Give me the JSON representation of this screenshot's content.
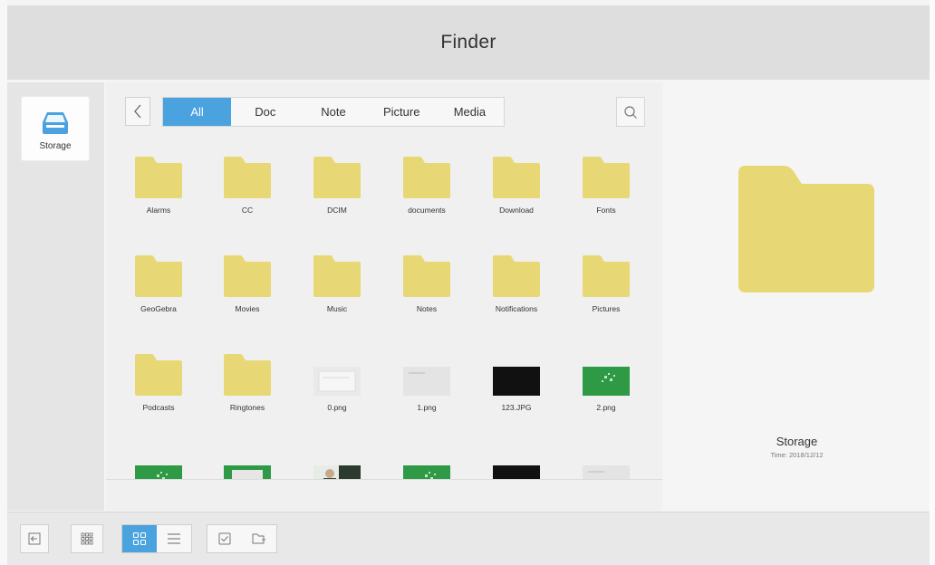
{
  "window": {
    "title": "Finder"
  },
  "sidebar": {
    "storage_label": "Storage",
    "storage_icon": "tray-icon"
  },
  "tabs": [
    {
      "label": "All",
      "active": true
    },
    {
      "label": "Doc",
      "active": false
    },
    {
      "label": "Note",
      "active": false
    },
    {
      "label": "Picture",
      "active": false
    },
    {
      "label": "Media",
      "active": false
    }
  ],
  "files": [
    {
      "name": "Alarms",
      "kind": "folder"
    },
    {
      "name": "CC",
      "kind": "folder"
    },
    {
      "name": "DCIM",
      "kind": "folder"
    },
    {
      "name": "documents",
      "kind": "folder"
    },
    {
      "name": "Download",
      "kind": "folder"
    },
    {
      "name": "Fonts",
      "kind": "folder"
    },
    {
      "name": "GeoGebra",
      "kind": "folder"
    },
    {
      "name": "Movies",
      "kind": "folder"
    },
    {
      "name": "Music",
      "kind": "folder"
    },
    {
      "name": "Notes",
      "kind": "folder"
    },
    {
      "name": "Notifications",
      "kind": "folder"
    },
    {
      "name": "Pictures",
      "kind": "folder"
    },
    {
      "name": "Podcasts",
      "kind": "folder"
    },
    {
      "name": "Ringtones",
      "kind": "folder"
    },
    {
      "name": "0.png",
      "kind": "image",
      "style": "light-doc"
    },
    {
      "name": "1.png",
      "kind": "image",
      "style": "light-plain"
    },
    {
      "name": "123.JPG",
      "kind": "image",
      "style": "dark"
    },
    {
      "name": "2.png",
      "kind": "image",
      "style": "green"
    },
    {
      "name": "",
      "kind": "image",
      "style": "green"
    },
    {
      "name": "",
      "kind": "image",
      "style": "green-screen"
    },
    {
      "name": "",
      "kind": "image",
      "style": "photo"
    },
    {
      "name": "",
      "kind": "image",
      "style": "green"
    },
    {
      "name": "",
      "kind": "image",
      "style": "dark"
    },
    {
      "name": "",
      "kind": "image",
      "style": "light-plain"
    }
  ],
  "preview": {
    "name": "Storage",
    "time": "Time: 2018/12/12"
  },
  "toolbar": {
    "exit_icon": "exit-icon",
    "apps_icon": "app-grid-icon",
    "grid_view_icon": "grid-view-icon",
    "list_view_icon": "list-view-icon",
    "select_icon": "checkbox-icon",
    "new_folder_icon": "new-folder-icon",
    "active_view": "grid"
  },
  "colors": {
    "accent": "#4aa3df",
    "folder": "#e8d875",
    "titlebar": "#dedede"
  }
}
